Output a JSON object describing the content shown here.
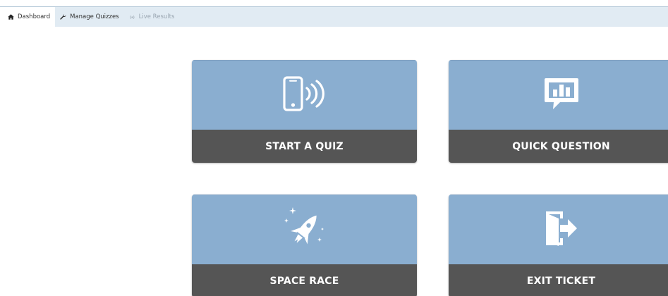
{
  "nav": {
    "tabs": [
      {
        "label": "Dashboard",
        "icon": "home-icon",
        "state": "active"
      },
      {
        "label": "Manage Quizzes",
        "icon": "wrench-icon",
        "state": "normal"
      },
      {
        "label": "Live Results",
        "icon": "live-icon",
        "state": "disabled"
      }
    ]
  },
  "tiles": [
    {
      "label": "START A QUIZ",
      "icon": "phone-signal-icon"
    },
    {
      "label": "QUICK QUESTION",
      "icon": "chart-bubble-icon"
    },
    {
      "label": "SPACE RACE",
      "icon": "rocket-icon"
    },
    {
      "label": "EXIT TICKET",
      "icon": "exit-door-icon"
    }
  ],
  "colors": {
    "nav_background": "#e1ebf3",
    "tile_top": "#8aaed0",
    "tile_bottom": "#555555",
    "tile_text": "#ffffff"
  }
}
